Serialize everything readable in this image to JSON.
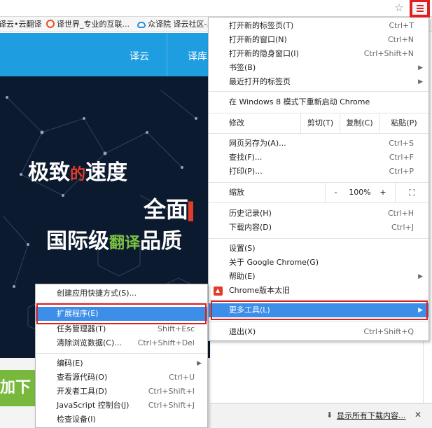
{
  "browser": {
    "menu_icon": "hamburger-menu-icon",
    "star_icon": "bookmark-star-icon",
    "bookmarks": [
      {
        "label": "译云•云翻译",
        "icon": "none"
      },
      {
        "label": "译世界_专业的互联...",
        "icon": "yishijie-logo-icon",
        "color": "#e8501e"
      },
      {
        "label": "众译院 译云社区-...",
        "icon": "cloud-icon",
        "color": "#2e8fd6"
      }
    ]
  },
  "page": {
    "nav": [
      "译云",
      "译库"
    ],
    "hero": {
      "line1a": "极致",
      "line1b": "的",
      "line1c": "速度",
      "line2": "全面",
      "line3a": "国际级",
      "line3b": "翻译",
      "line3c": "品质"
    },
    "green_button": "加下",
    "download_bar": {
      "text": "显示所有下载内容...",
      "close": "✕"
    }
  },
  "menu": {
    "new_tab": {
      "label": "打开新的标签页(T)",
      "shortcut": "Ctrl+T"
    },
    "new_window": {
      "label": "打开新的窗口(N)",
      "shortcut": "Ctrl+N"
    },
    "new_incognito": {
      "label": "打开新的隐身窗口(I)",
      "shortcut": "Ctrl+Shift+N"
    },
    "bookmarks": {
      "label": "书签(B)"
    },
    "recent_tabs": {
      "label": "最近打开的标签页"
    },
    "relaunch": {
      "label": "在 Windows 8 模式下重新启动 Chrome"
    },
    "edit": {
      "label": "修改",
      "cut": "剪切(T)",
      "copy": "复制(C)",
      "paste": "粘贴(P)"
    },
    "save_as": {
      "label": "网页另存为(A)...",
      "shortcut": "Ctrl+S"
    },
    "find": {
      "label": "查找(F)...",
      "shortcut": "Ctrl+F"
    },
    "print": {
      "label": "打印(P)...",
      "shortcut": "Ctrl+P"
    },
    "zoom": {
      "label": "缩放",
      "minus": "-",
      "value": "100%",
      "plus": "+",
      "fullscreen_icon": "fullscreen-icon"
    },
    "history": {
      "label": "历史记录(H)",
      "shortcut": "Ctrl+H"
    },
    "downloads": {
      "label": "下载内容(D)",
      "shortcut": "Ctrl+J"
    },
    "settings": {
      "label": "设置(S)"
    },
    "about": {
      "label": "关于 Google Chrome(G)"
    },
    "help": {
      "label": "帮助(E)"
    },
    "update": {
      "label": "Chrome版本太旧",
      "icon": "update-arrow-icon"
    },
    "more_tools": {
      "label": "更多工具(L)"
    },
    "exit": {
      "label": "退出(X)",
      "shortcut": "Ctrl+Shift+Q"
    }
  },
  "submenu": {
    "create_shortcut": {
      "label": "创建应用快捷方式(S)..."
    },
    "extensions": {
      "label": "扩展程序(E)"
    },
    "task_manager": {
      "label": "任务管理器(T)",
      "shortcut": "Shift+Esc"
    },
    "clear_data": {
      "label": "清除浏览数据(C)...",
      "shortcut": "Ctrl+Shift+Del"
    },
    "encoding": {
      "label": "编码(E)"
    },
    "view_source": {
      "label": "查看源代码(O)",
      "shortcut": "Ctrl+U"
    },
    "dev_tools": {
      "label": "开发者工具(D)",
      "shortcut": "Ctrl+Shift+I"
    },
    "js_console": {
      "label": "JavaScript 控制台(J)",
      "shortcut": "Ctrl+Shift+J"
    },
    "inspect": {
      "label": "检查设备(I)"
    }
  },
  "colors": {
    "highlight": "#3c8ee9",
    "annotation_red": "#e02020",
    "nav_blue": "#1e9de0",
    "hero_bg": "#0b1a2e",
    "accent_green": "#7bc043"
  }
}
